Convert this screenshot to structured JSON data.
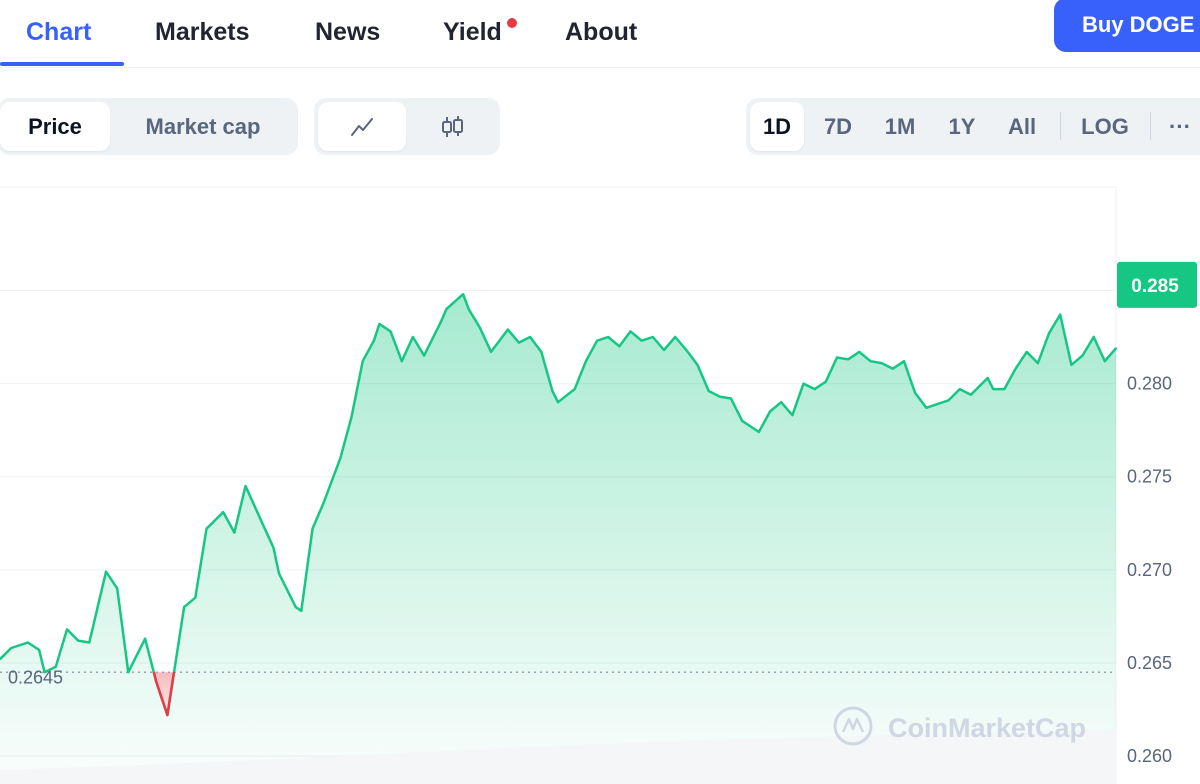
{
  "tabs": [
    {
      "label": "Chart"
    },
    {
      "label": "Markets"
    },
    {
      "label": "News"
    },
    {
      "label": "Yield"
    },
    {
      "label": "About"
    }
  ],
  "buy_button": "Buy DOGE",
  "metric_toggle": {
    "price": "Price",
    "market_cap": "Market cap",
    "selected": "Price"
  },
  "chart_style_toggle": {
    "line_icon": "line-chart-icon",
    "candle_icon": "candlestick-icon",
    "selected": "line"
  },
  "range_toggle": {
    "options": [
      "1D",
      "7D",
      "1M",
      "1Y",
      "All"
    ],
    "selected": "1D",
    "log": "LOG",
    "more": "···"
  },
  "colors": {
    "accent": "#3861fb",
    "up": "#16c784",
    "down": "#ea3943"
  },
  "chart_data": {
    "type": "area",
    "title": "",
    "xlabel": "",
    "ylabel": "",
    "ylim": [
      0.2585,
      0.2905
    ],
    "yticks": [
      0.26,
      0.265,
      0.27,
      0.275,
      0.28,
      0.285
    ],
    "ytick_labels": [
      "0.260",
      "0.265",
      "0.270",
      "0.275",
      "0.280",
      "0.285"
    ],
    "reference_value": 0.2645,
    "reference_label": "0.2645",
    "current_price": 0.2853,
    "current_price_label": "0.285",
    "grid": true,
    "watermark": "CoinMarketCap",
    "x_index": [
      0,
      2,
      5,
      7,
      8,
      10,
      12,
      14,
      16,
      19,
      21,
      23,
      26,
      28,
      30,
      33,
      35,
      37,
      40,
      42,
      44,
      47,
      49,
      50,
      53,
      54,
      56,
      58,
      61,
      63,
      65,
      67,
      68,
      70,
      72,
      74,
      76,
      79,
      80,
      83,
      84,
      86,
      88,
      91,
      93,
      95,
      97,
      99,
      100,
      103,
      105,
      107,
      109,
      111,
      113,
      115,
      117,
      119,
      121,
      123,
      125,
      127,
      129,
      131,
      133,
      136,
      138,
      140,
      142,
      144,
      146,
      148,
      150,
      152,
      154,
      156,
      158,
      160,
      162,
      164,
      166,
      168,
      170,
      172,
      174,
      177,
      178,
      180,
      182,
      184,
      186,
      188,
      190,
      192,
      194,
      196,
      198,
      200
    ],
    "values": [
      0.2652,
      0.2658,
      0.2661,
      0.2657,
      0.2645,
      0.2648,
      0.2668,
      0.2662,
      0.2661,
      0.2699,
      0.269,
      0.2645,
      0.2663,
      0.264,
      0.2622,
      0.268,
      0.2685,
      0.2722,
      0.2731,
      0.272,
      0.2745,
      0.2725,
      0.2712,
      0.2698,
      0.268,
      0.2678,
      0.2722,
      0.2736,
      0.276,
      0.2782,
      0.2812,
      0.2823,
      0.2832,
      0.2828,
      0.2812,
      0.2825,
      0.2815,
      0.2833,
      0.284,
      0.2848,
      0.284,
      0.283,
      0.2817,
      0.2829,
      0.2822,
      0.2825,
      0.2817,
      0.2796,
      0.279,
      0.2797,
      0.2812,
      0.2823,
      0.2825,
      0.282,
      0.2828,
      0.2823,
      0.2825,
      0.2818,
      0.2825,
      0.2818,
      0.281,
      0.2796,
      0.2793,
      0.2792,
      0.278,
      0.2774,
      0.2785,
      0.279,
      0.2783,
      0.28,
      0.2797,
      0.2801,
      0.2814,
      0.2813,
      0.2817,
      0.2812,
      0.2811,
      0.2808,
      0.2812,
      0.2795,
      0.2787,
      0.2789,
      0.2791,
      0.2797,
      0.2794,
      0.2803,
      0.2797,
      0.2797,
      0.2808,
      0.2817,
      0.2811,
      0.2827,
      0.2837,
      0.281,
      0.2815,
      0.2825,
      0.2812,
      0.2819,
      0.2823,
      0.283,
      0.2845,
      0.2853
    ]
  }
}
